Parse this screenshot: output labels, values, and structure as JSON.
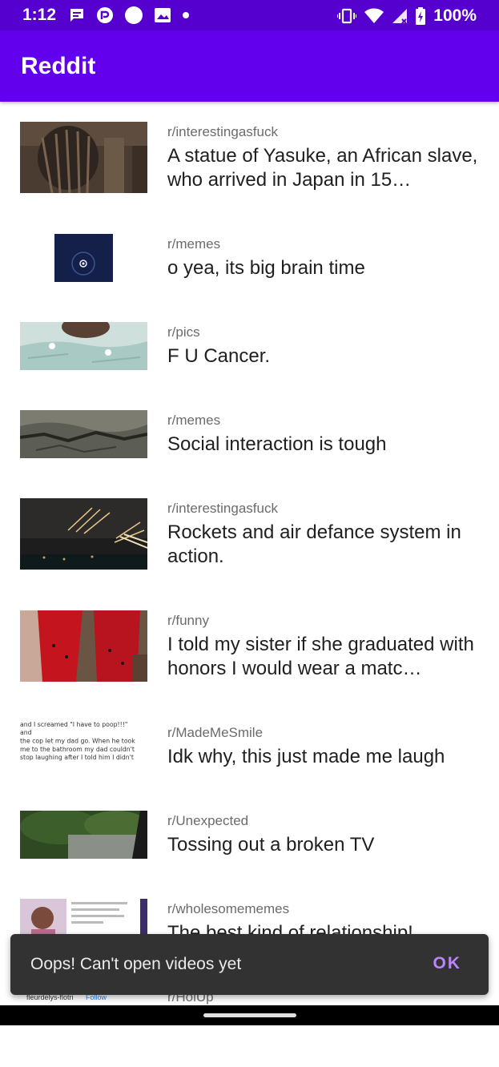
{
  "status_bar": {
    "time": "1:12",
    "battery": "100%",
    "icons_left": [
      "message-icon",
      "pocketcasts-icon",
      "circle-icon",
      "image-icon",
      "dot-icon"
    ],
    "icons_right": [
      "vibrate-icon",
      "wifi-icon",
      "signal-icon",
      "battery-icon"
    ]
  },
  "app_bar": {
    "title": "Reddit",
    "color": "#6200ee"
  },
  "posts": [
    {
      "subreddit": "r/interestingasfuck",
      "title": "A statue of Yasuke, an African slave, who arrived in Japan in 15…"
    },
    {
      "subreddit": "r/memes",
      "title": "o yea, its big brain time"
    },
    {
      "subreddit": "r/pics",
      "title": "F U Cancer."
    },
    {
      "subreddit": "r/memes",
      "title": "Social interaction is tough"
    },
    {
      "subreddit": "r/interestingasfuck",
      "title": "Rockets and air defance system in action."
    },
    {
      "subreddit": "r/funny",
      "title": "I told my sister if she graduated with honors I would wear a matc…"
    },
    {
      "subreddit": "r/MadeMeSmile",
      "title": "Idk why, this just made me laugh"
    },
    {
      "subreddit": "r/Unexpected",
      "title": "Tossing out a broken TV"
    },
    {
      "subreddit": "r/wholesomememes",
      "title": "The best kind of relationship!"
    },
    {
      "subreddit": "r/HolUp",
      "title": ""
    }
  ],
  "thumb_text": {
    "madememesmile_lines": [
      "and I screamed \"I have to poop!!!\" and",
      "the cop let my dad go. When he took",
      "me to the bathroom my dad couldn't",
      "stop laughing after I told him I didn't"
    ],
    "holup_caption": "fleurdelys-flotri",
    "holup_follow": "Follow"
  },
  "snackbar": {
    "message": "Oops! Can't open videos yet",
    "action": "OK"
  },
  "colors": {
    "status_bar": "#5600d0",
    "accent": "#bb86fc",
    "snackbar_bg": "#323232"
  }
}
